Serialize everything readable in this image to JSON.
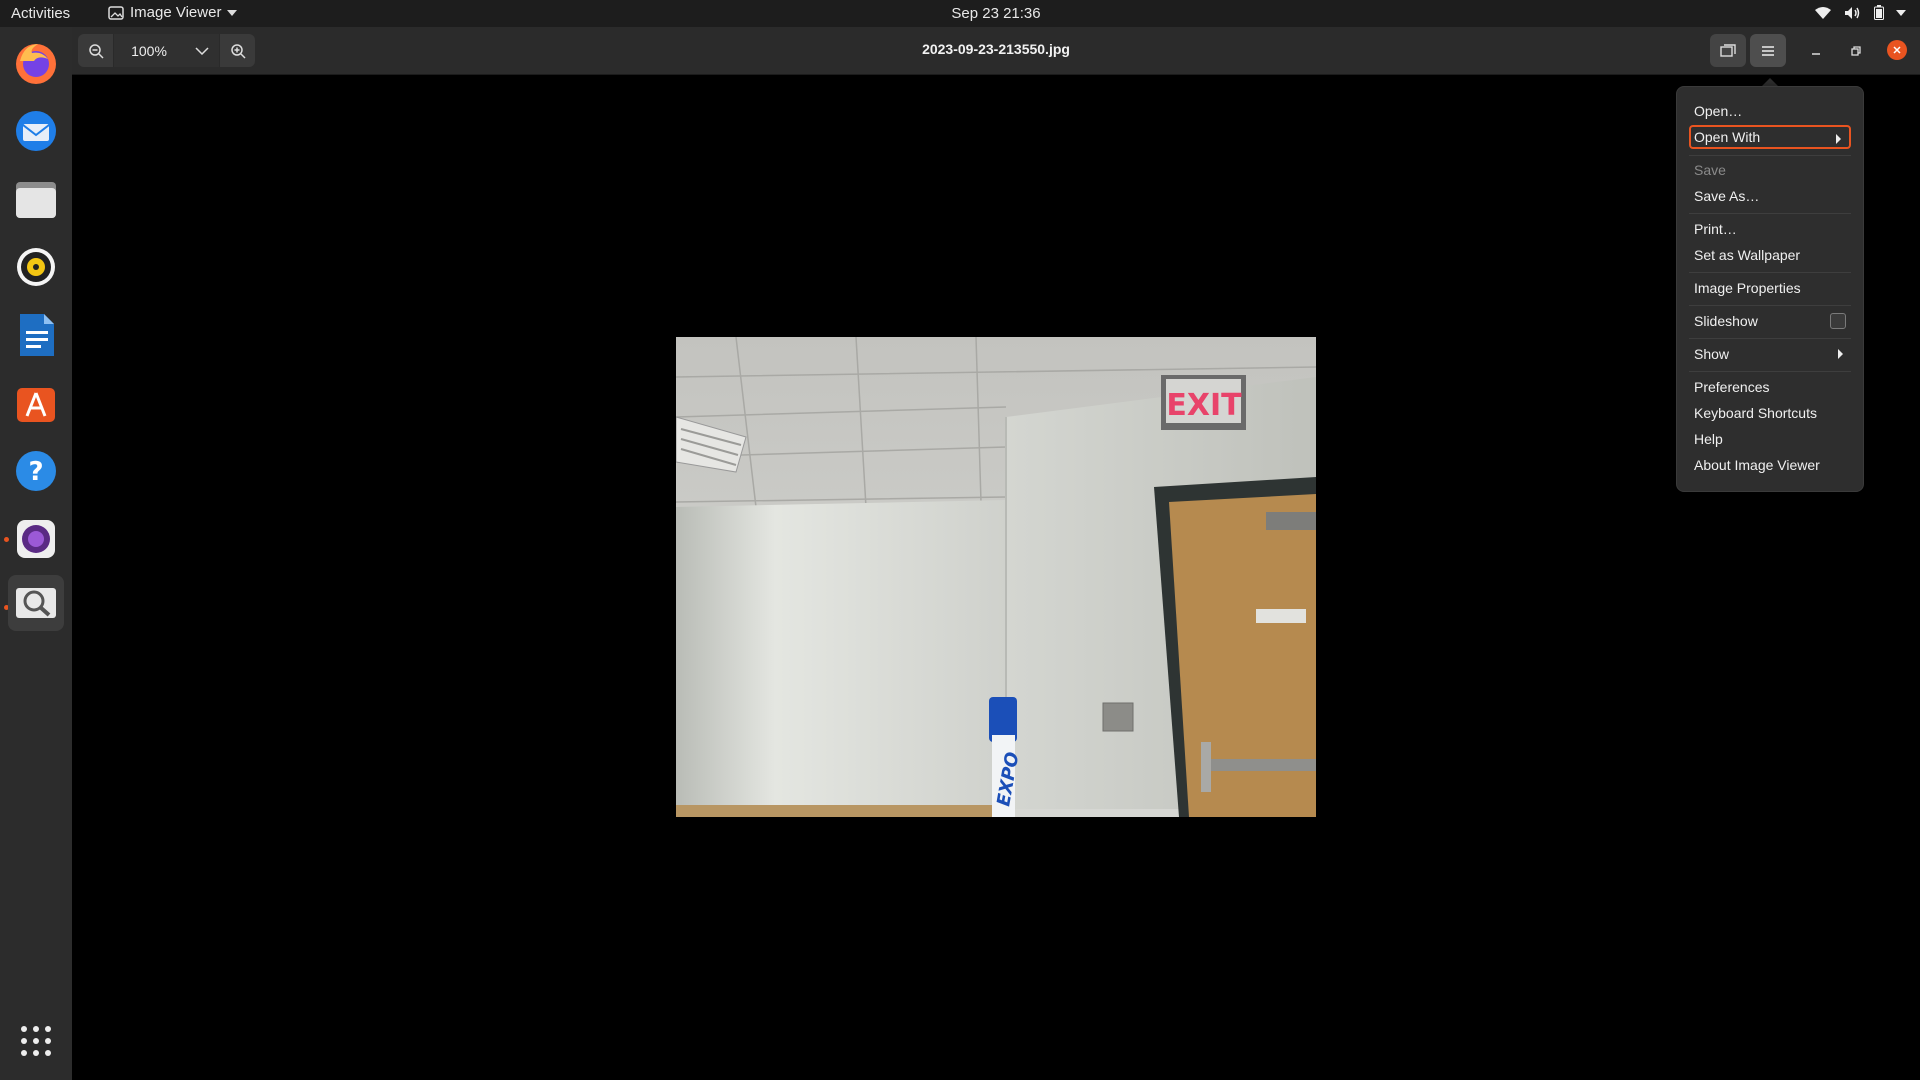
{
  "topbar": {
    "activities": "Activities",
    "app_name": "Image Viewer",
    "clock": "Sep 23  21:36"
  },
  "dock": {
    "items": [
      "firefox-icon",
      "thunderbird-icon",
      "files-icon",
      "rhythmbox-icon",
      "writer-icon",
      "software-icon",
      "help-icon",
      "camera-icon",
      "image-viewer-icon",
      "app-grid-icon"
    ]
  },
  "header": {
    "zoom_value": "100%",
    "title": "2023-09-23-213550.jpg"
  },
  "photo": {
    "exit_sign": "EXIT",
    "marker_text": "EXPO"
  },
  "menu": {
    "items": [
      {
        "label": "Open…"
      },
      {
        "label": "Open With"
      },
      {
        "label": "Save"
      },
      {
        "label": "Save As…"
      },
      {
        "label": "Print…"
      },
      {
        "label": "Set as Wallpaper"
      },
      {
        "label": "Image Properties"
      },
      {
        "label": "Slideshow"
      },
      {
        "label": "Show"
      },
      {
        "label": "Preferences"
      },
      {
        "label": "Keyboard Shortcuts"
      },
      {
        "label": "Help"
      },
      {
        "label": "About Image Viewer"
      }
    ]
  },
  "colors": {
    "accent": "#e95420"
  }
}
